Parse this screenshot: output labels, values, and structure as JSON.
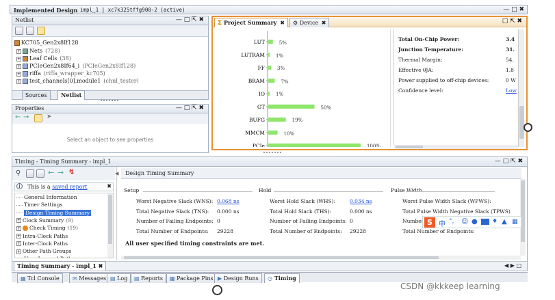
{
  "window": {
    "title": "Implemented Design",
    "subtitle": "impl_1 | xc7k325tffg900-2 (active)"
  },
  "netlist": {
    "title": "Netlist",
    "root": "KC705_Gen2x8If128",
    "items": [
      {
        "label": "Nets",
        "count": "(728)"
      },
      {
        "label": "Leaf Cells",
        "count": "(38)"
      },
      {
        "label": "PCIeGen2x8If64_i",
        "count": "(PCIeGen2x8If128)"
      },
      {
        "label": "riffa",
        "count": "(riffa_wrapper_kc705)"
      },
      {
        "label": "test_channels[0].module1",
        "count": "(chnl_tester)"
      }
    ],
    "tabs": [
      "Sources",
      "Netlist"
    ]
  },
  "properties": {
    "title": "Properties",
    "empty": "Select an object to see properties"
  },
  "summary_tabs": [
    "Project Summary",
    "Device"
  ],
  "utilization": {
    "categories": [
      "LUT",
      "LUTRAM",
      "FF",
      "BRAM",
      "IO",
      "GT",
      "BUFG",
      "MMCM",
      "PCIe"
    ],
    "values": [
      5,
      1,
      3,
      7,
      1,
      50,
      19,
      10,
      100
    ],
    "labels": [
      "5%",
      "1%",
      "3%",
      "7%",
      "1%",
      "50%",
      "19%",
      "10%",
      "100%"
    ]
  },
  "power": {
    "rows": [
      {
        "k": "Total On-Chip Power:",
        "v": "3.4",
        "bold": true
      },
      {
        "k": "Junction Temperature:",
        "v": "31.",
        "bold": true
      },
      {
        "k": "Thermal Margin:",
        "v": "54.",
        "bold": false
      },
      {
        "k": "Effective θJA:",
        "v": "1.8",
        "bold": false
      },
      {
        "k": "Power supplied to off-chip devices:",
        "v": "0 W",
        "bold": false
      },
      {
        "k": "Confidence level:",
        "v": "Low",
        "bold": false
      }
    ]
  },
  "timing": {
    "title": "Timing - Timing Summary - impl_1",
    "info": "This is a",
    "info_link": "saved report",
    "tree": [
      {
        "label": "General Information",
        "sel": false
      },
      {
        "label": "Timer Settings",
        "sel": false
      },
      {
        "label": "Design Timing Summary",
        "sel": true
      },
      {
        "label": "Clock Summary",
        "count": "(9)",
        "sel": false
      },
      {
        "label": "Check Timing",
        "count": "(19)",
        "sel": false
      },
      {
        "label": "Intra-Clock Paths",
        "sel": false
      },
      {
        "label": "Inter-Clock Paths",
        "sel": false
      },
      {
        "label": "Other Path Groups",
        "sel": false
      },
      {
        "label": "User Ignored Paths",
        "sel": false
      }
    ],
    "content_title": "Design Timing Summary",
    "setup": {
      "hdr": "Setup",
      "rows": [
        {
          "k": "Worst Negative Slack (WNS):",
          "v": "0.068 ns",
          "link": true
        },
        {
          "k": "Total Negative Slack (TNS):",
          "v": "0.000 ns",
          "link": false
        },
        {
          "k": "Number of Failing Endpoints:",
          "v": "0",
          "link": false
        },
        {
          "k": "Total Number of Endpoints:",
          "v": "29228",
          "link": false
        }
      ]
    },
    "hold": {
      "hdr": "Hold",
      "rows": [
        {
          "k": "Worst Hold Slack (WHS):",
          "v": "0.034 ns",
          "link": true
        },
        {
          "k": "Total Hold Slack (THS):",
          "v": "0.000 ns",
          "link": false
        },
        {
          "k": "Number of Failing Endpoints:",
          "v": "0",
          "link": false
        },
        {
          "k": "Total Number of Endpoints:",
          "v": "29228",
          "link": false
        }
      ]
    },
    "pw": {
      "hdr": "Pulse Width",
      "rows": [
        {
          "k": "Worst Pulse Width Slack (WPWS):"
        },
        {
          "k": "Total Pulse Width Negative Slack (TPWS)"
        },
        {
          "k": "Number"
        },
        {
          "k": "Total Number of Endpoints:"
        }
      ]
    },
    "message": "All user specified timing constraints are met.",
    "bottom_tab": "Timing Summary - impl_1"
  },
  "status_tabs": [
    "Tcl Console",
    "Messages",
    "Log",
    "Reports",
    "Package Pins",
    "Design Runs",
    "Timing"
  ],
  "ime_label": "中",
  "watermark": "CSDN @kkkeep learning"
}
